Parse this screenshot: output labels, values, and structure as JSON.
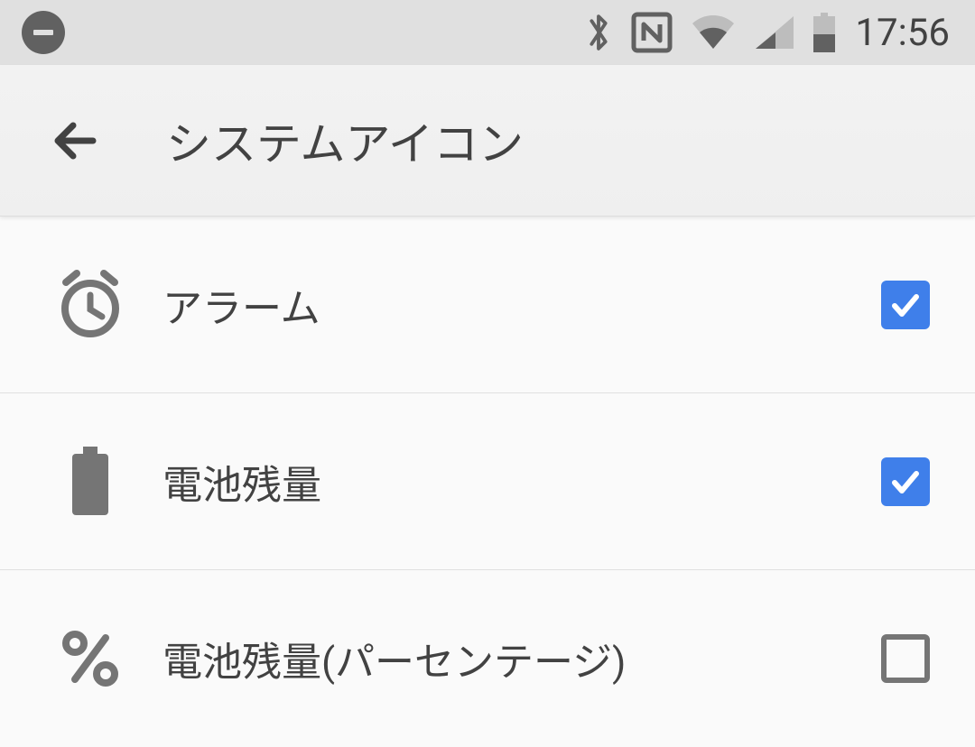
{
  "status_bar": {
    "clock": "17:56"
  },
  "app_bar": {
    "title": "システムアイコン"
  },
  "rows": [
    {
      "icon": "alarm",
      "label": "アラーム",
      "checked": true
    },
    {
      "icon": "battery",
      "label": "電池残量",
      "checked": true
    },
    {
      "icon": "percent",
      "label": "電池残量(パーセンテージ)",
      "checked": false
    }
  ],
  "colors": {
    "accent": "#3f7fea",
    "icon_gray": "#757575",
    "text": "#424242"
  }
}
